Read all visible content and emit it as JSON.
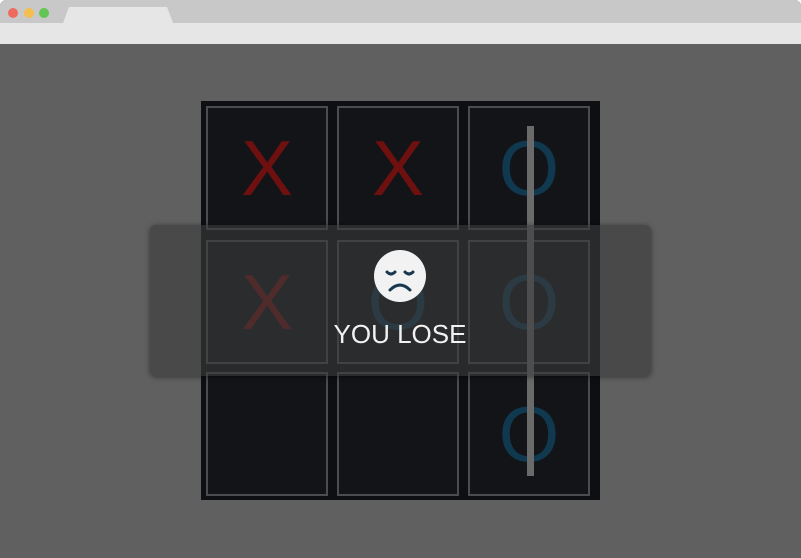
{
  "board": {
    "cells": [
      "X",
      "X",
      "O",
      "X",
      "O",
      "O",
      "",
      "",
      "O"
    ]
  },
  "result": {
    "message": "YOU LOSE",
    "icon": "sad-face-icon"
  },
  "colors": {
    "x": "#6e1010",
    "o": "#10384f",
    "background": "#606060",
    "board": "#0d0f13"
  }
}
